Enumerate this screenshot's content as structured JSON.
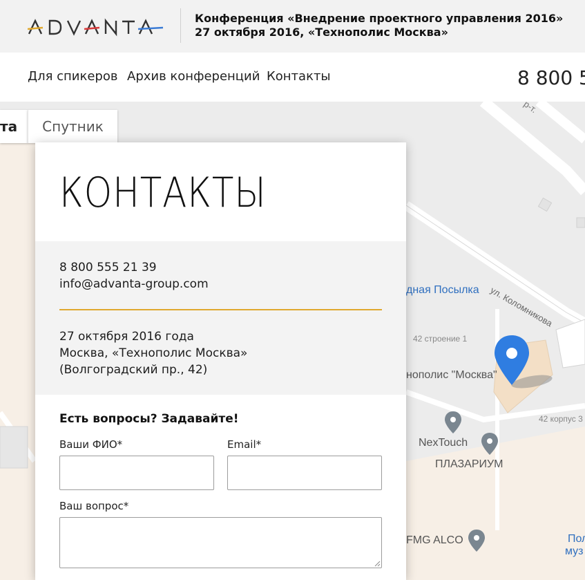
{
  "header": {
    "logo_text": "ADVANTA",
    "conf_line1": "Конференция «Внедрение проектного управления 2016»",
    "conf_line2": "27 октября 2016, «Технополис Москва»"
  },
  "nav": {
    "items": [
      "Для спикеров",
      "Архив конференций",
      "Контакты"
    ],
    "phone": "8 800 5"
  },
  "map": {
    "tab_map": "та",
    "tab_satellite": "Спутник",
    "labels": {
      "street": "ул. Коломникова",
      "posylka": "дная Посылка",
      "bldg1": "42 строение 1",
      "technopolis": "нополис \"Москва\"",
      "korpus": "42 корпус 3",
      "nextouch": "NexTouch",
      "plazarium": "ПЛАЗАРИУМ",
      "fmg": "FMG ALCO",
      "pol": "Пол",
      "muz": "муз",
      "road_top": "р-т."
    },
    "colors": {
      "blue_label": "#2f6fbf",
      "pin_blue": "#2f7de1",
      "poi_gray": "#7a8690"
    }
  },
  "card": {
    "title": "КОНТАКТЫ",
    "phone": "8 800 555 21 39",
    "email": "info@advanta-group.com",
    "date": "27 октября 2016 года",
    "place": "Москва, «Технополис Москва»",
    "address": "(Волгоградский пр., 42)",
    "form_heading": "Есть вопросы? Задавайте!",
    "name_label": "Ваши ФИО*",
    "email_label": "Email*",
    "question_label": "Ваш вопрос*",
    "name_value": "",
    "email_value": "",
    "question_value": ""
  },
  "colors": {
    "accent": "#e0a82e",
    "header_bg": "#f2f2f2",
    "info_bg": "#f3f3f3"
  }
}
